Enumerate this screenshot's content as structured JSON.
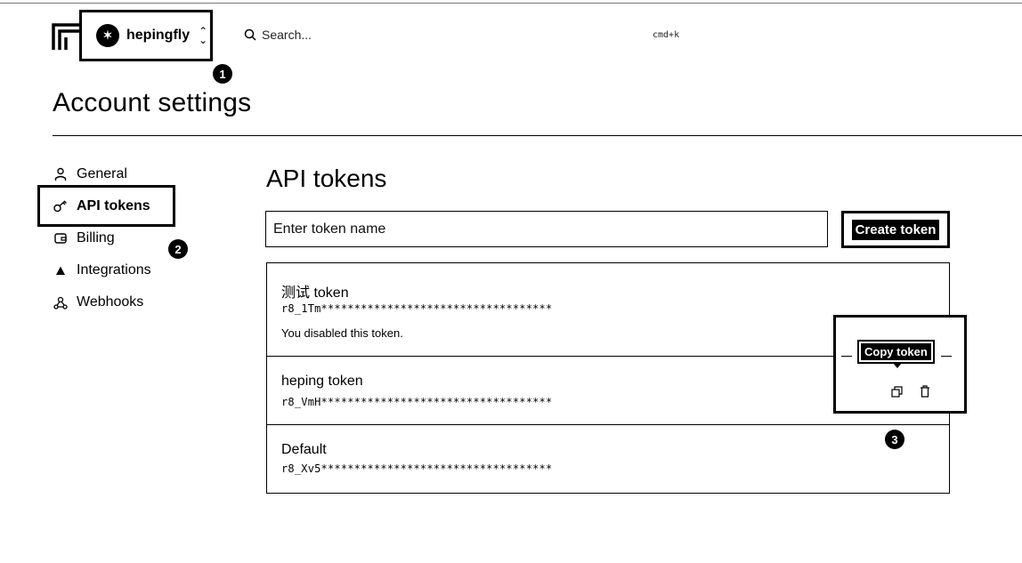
{
  "header": {
    "account_name": "hepingfly",
    "search_placeholder": "Search...",
    "search_shortcut": "cmd+k"
  },
  "page_title": "Account settings",
  "sidebar": {
    "items": [
      {
        "label": "General",
        "icon": "user-icon"
      },
      {
        "label": "API tokens",
        "icon": "key-icon",
        "active": true
      },
      {
        "label": "Billing",
        "icon": "wallet-icon"
      },
      {
        "label": "Integrations",
        "icon": "triangle-icon"
      },
      {
        "label": "Webhooks",
        "icon": "webhook-icon"
      }
    ]
  },
  "main": {
    "section_title": "API tokens",
    "token_name_placeholder": "Enter token name",
    "create_button_label": "Create token",
    "tokens": [
      {
        "name": "测试 token",
        "value": "r8_1Tm***********************************",
        "note": "You disabled this token."
      },
      {
        "name": "heping token",
        "value": "r8_VmH***********************************"
      },
      {
        "name": "Default",
        "value": "r8_Xv5***********************************"
      }
    ],
    "copy_tooltip": "Copy token"
  },
  "markers": [
    "1",
    "2",
    "3"
  ]
}
